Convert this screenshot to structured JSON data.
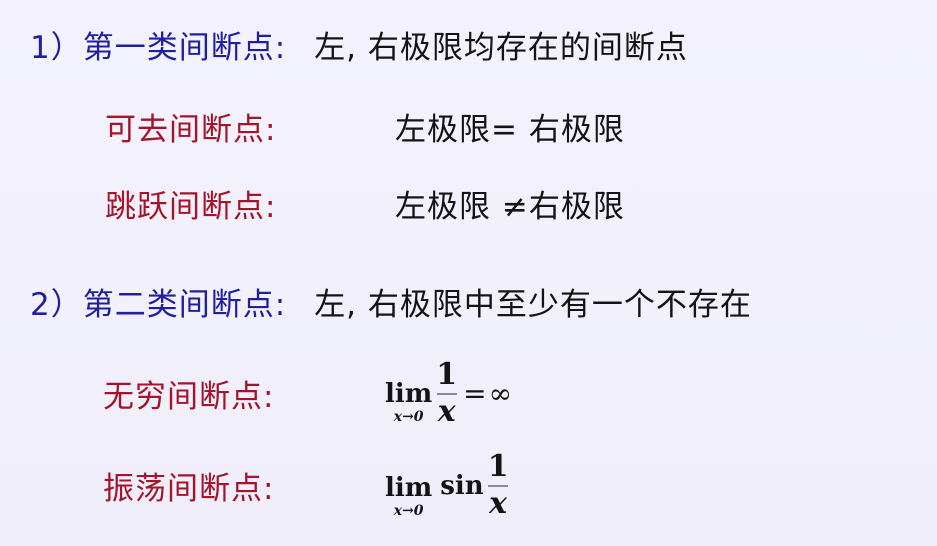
{
  "section1": {
    "number": "1）",
    "title": "第一类间断点:",
    "description": "左, 右极限均存在的间断点",
    "items": [
      {
        "label": "可去间断点:",
        "condition": "左极限= 右极限"
      },
      {
        "label": "跳跃间断点:",
        "condition": "左极限 ≠右极限"
      }
    ]
  },
  "section2": {
    "number": "2）",
    "title": "第二类间断点:",
    "description": "左, 右极限中至少有一个不存在",
    "items": [
      {
        "label": "无穷间断点:",
        "formula": {
          "lim": "lim",
          "sub": "x→0",
          "numerator": "1",
          "denominator": "x",
          "equals": "=",
          "result": "∞"
        }
      },
      {
        "label": "振荡间断点:",
        "formula": {
          "lim": "lim",
          "sub": "x→0",
          "func": "sin",
          "numerator": "1",
          "denominator": "x"
        }
      }
    ]
  }
}
